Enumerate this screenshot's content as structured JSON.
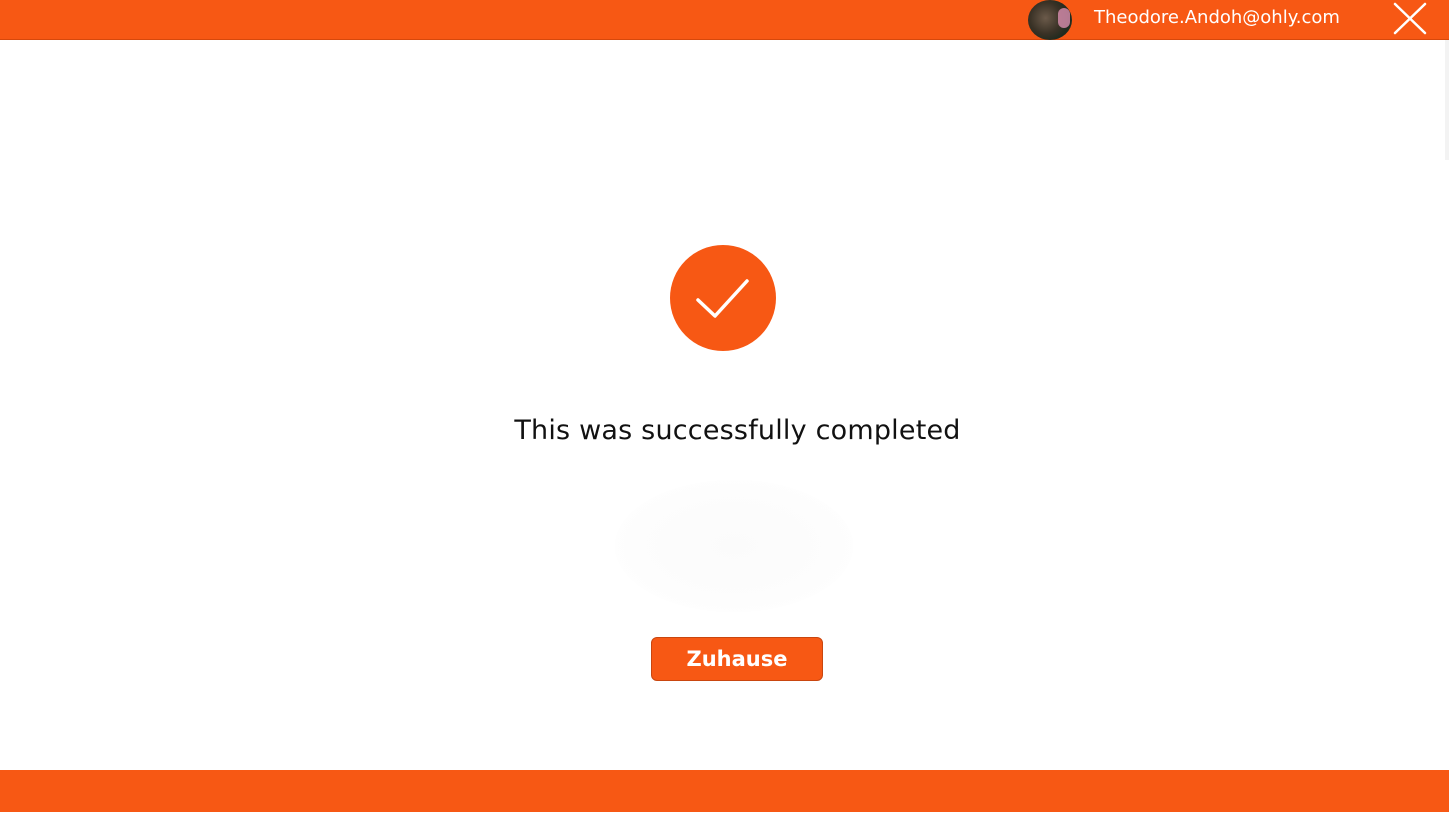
{
  "header": {
    "user_email": "Theodore.Andoh@ohly.com",
    "avatar_icon": "user-avatar",
    "close_icon": "close-icon"
  },
  "main": {
    "status_icon": "checkmark-icon",
    "message": "This was successfully completed",
    "home_button_label": "Zuhause"
  },
  "colors": {
    "accent": "#f75814",
    "text": "#111111",
    "background": "#ffffff"
  }
}
